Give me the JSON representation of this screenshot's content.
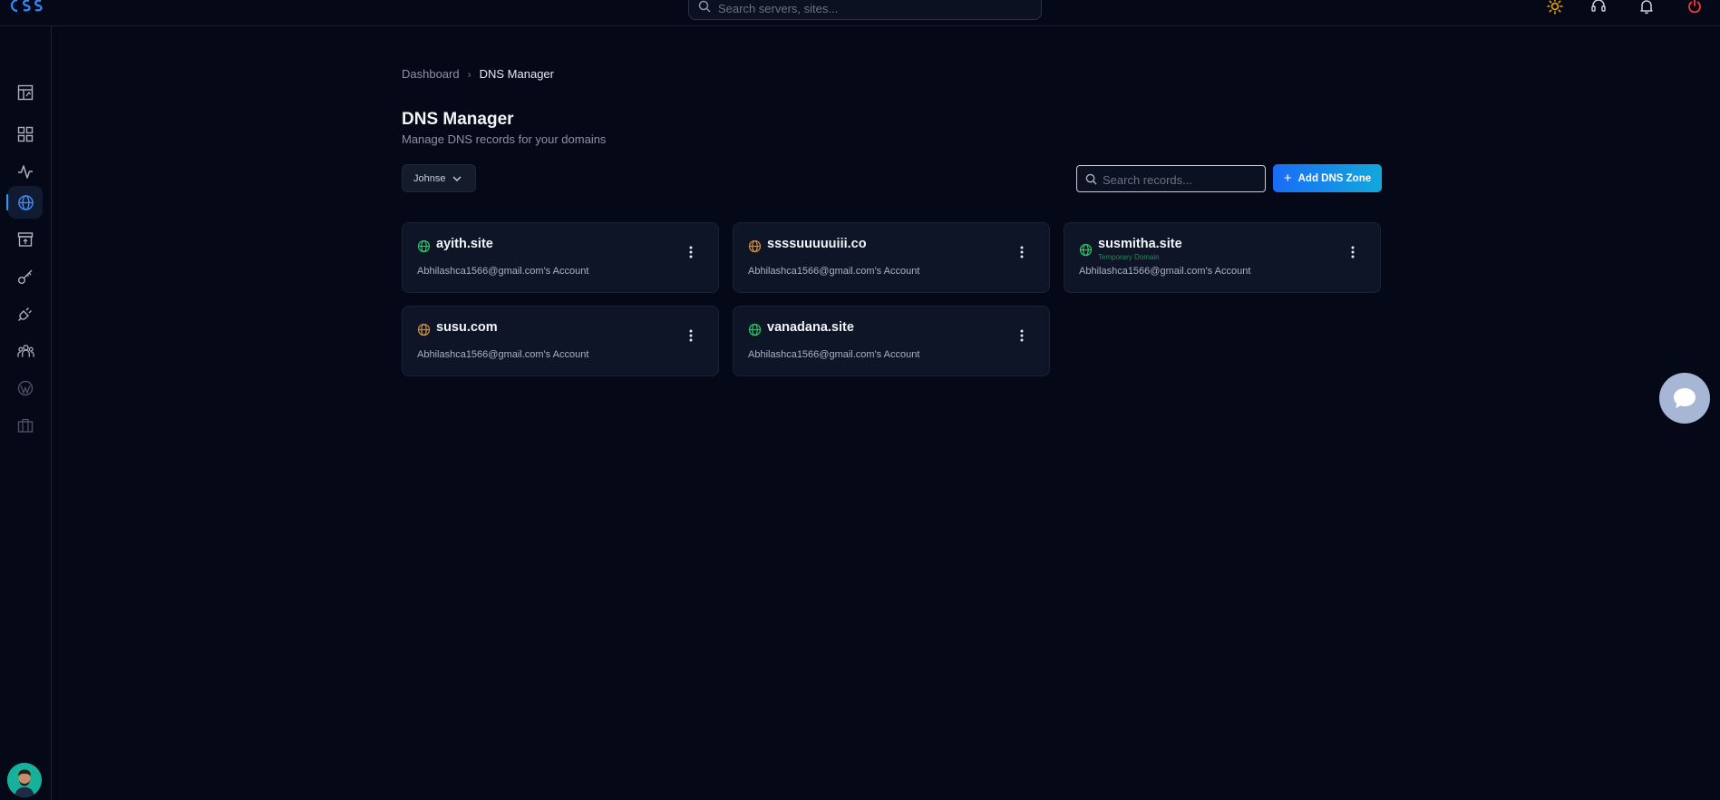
{
  "topbar": {
    "logo_text": "css",
    "search_placeholder": "Search servers, sites...",
    "icons": [
      "sun-icon",
      "headset-icon",
      "bell-icon",
      "power-icon"
    ]
  },
  "sidebar": {
    "items": [
      {
        "icon": "dashboard-icon",
        "active": false
      },
      {
        "icon": "grid-icon",
        "active": false
      },
      {
        "icon": "activity-icon",
        "active": false
      },
      {
        "icon": "globe-icon",
        "active": true
      },
      {
        "icon": "archive-icon",
        "active": false
      },
      {
        "icon": "key-icon",
        "active": false
      },
      {
        "icon": "plug-icon",
        "active": false
      },
      {
        "icon": "team-icon",
        "active": false
      },
      {
        "icon": "wordpress-icon",
        "active": false
      },
      {
        "icon": "briefcase-icon",
        "active": false
      }
    ]
  },
  "breadcrumb": {
    "parent": "Dashboard",
    "current": "DNS Manager"
  },
  "header": {
    "title": "DNS Manager",
    "subtitle": "Manage DNS records for your domains"
  },
  "toolbar": {
    "account_selected": "Johnse",
    "search_placeholder": "Search records...",
    "add_label": "Add DNS Zone"
  },
  "zones": [
    {
      "domain": "ayith.site",
      "owner": "Abhilashca1566@gmail.com's Account",
      "status_color": "#22c55e",
      "badge": ""
    },
    {
      "domain": "ssssuuuuuiii.co",
      "owner": "Abhilashca1566@gmail.com's Account",
      "status_color": "#d08a3a",
      "badge": ""
    },
    {
      "domain": "susmitha.site",
      "owner": "Abhilashca1566@gmail.com's Account",
      "status_color": "#22c55e",
      "badge": "Temporary Domain"
    },
    {
      "domain": "susu.com",
      "owner": "Abhilashca1566@gmail.com's Account",
      "status_color": "#d08a3a",
      "badge": ""
    },
    {
      "domain": "vanadana.site",
      "owner": "Abhilashca1566@gmail.com's Account",
      "status_color": "#22c55e",
      "badge": ""
    }
  ],
  "colors": {
    "background": "#050816",
    "accent": "#1a6cf5",
    "accent_end": "#12a9db",
    "card": "#0e1526"
  }
}
